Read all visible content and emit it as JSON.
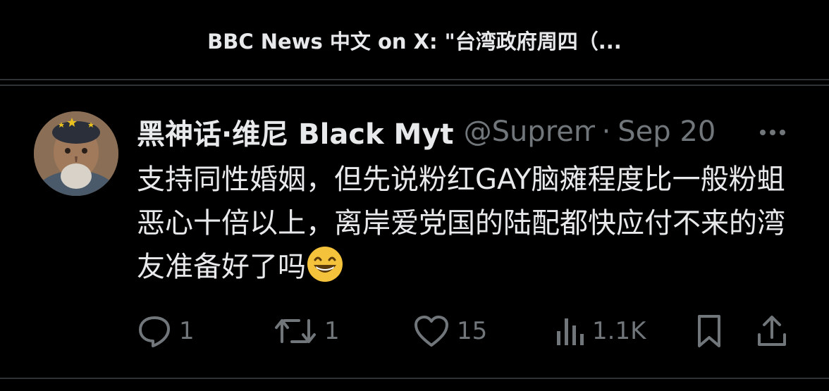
{
  "header": {
    "title": "BBC News 中文 on X: \"台湾政府周四（..."
  },
  "tweet": {
    "display_name": "黑神话·维尼 Black Myt",
    "handle": "@Suprem",
    "dot": "·",
    "date": "Sep 20",
    "text": "支持同性婚姻，但先说粉红GAY脑瘫程度比一般粉蛆恶心十倍以上，离岸爱党国的陆配都快应付不来的湾友准备好了吗",
    "emoji": "grinning-face-with-smiling-eyes",
    "actions": {
      "replies": "1",
      "reposts": "1",
      "likes": "15",
      "views": "1.1K"
    }
  },
  "colors": {
    "background": "#000000",
    "primary_text": "#e7e9ea",
    "secondary_text": "#71767b",
    "divider": "#2f3336"
  },
  "icons": [
    "reply-icon",
    "repost-icon",
    "like-icon",
    "views-icon",
    "bookmark-icon",
    "share-icon",
    "more-icon"
  ]
}
